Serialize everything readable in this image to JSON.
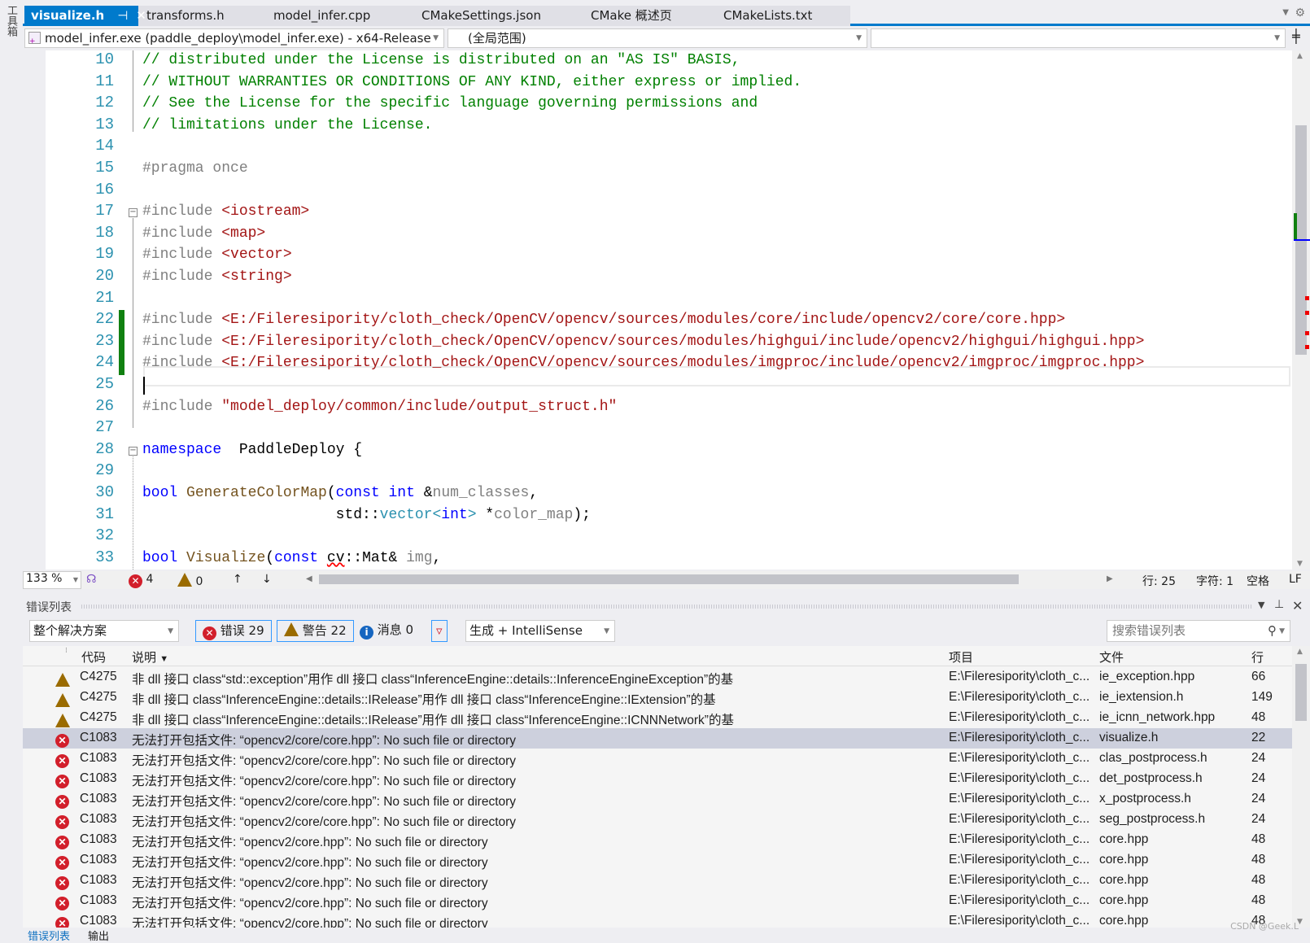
{
  "toolbox_label": "工具箱",
  "tabs": [
    {
      "label": "visualize.h",
      "active": true
    },
    {
      "label": "transforms.h"
    },
    {
      "label": "model_infer.cpp"
    },
    {
      "label": "CMakeSettings.json"
    },
    {
      "label": "CMake 概述页"
    },
    {
      "label": "CMakeLists.txt"
    }
  ],
  "nav": {
    "project": "model_infer.exe (paddle_deploy\\model_infer.exe) - x64-Release",
    "scope": "(全局范围)",
    "member": ""
  },
  "editor": {
    "lines": [
      {
        "n": "10",
        "tokens": [
          [
            "c",
            "// distributed under the License is distributed on an \"AS IS\" BASIS,"
          ]
        ]
      },
      {
        "n": "11",
        "tokens": [
          [
            "c",
            "// WITHOUT WARRANTIES OR CONDITIONS OF ANY KIND, either express or implied."
          ]
        ]
      },
      {
        "n": "12",
        "tokens": [
          [
            "c",
            "// See the License for the specific language governing permissions and"
          ]
        ]
      },
      {
        "n": "13",
        "tokens": [
          [
            "c",
            "// limitations under the License."
          ]
        ]
      },
      {
        "n": "14",
        "tokens": []
      },
      {
        "n": "15",
        "tokens": [
          [
            "p",
            "#pragma once"
          ]
        ]
      },
      {
        "n": "16",
        "tokens": []
      },
      {
        "n": "17",
        "tokens": [
          [
            "p",
            "#include "
          ],
          [
            "s",
            "<iostream>"
          ]
        ]
      },
      {
        "n": "18",
        "tokens": [
          [
            "p",
            "#include "
          ],
          [
            "s",
            "<map>"
          ]
        ]
      },
      {
        "n": "19",
        "tokens": [
          [
            "p",
            "#include "
          ],
          [
            "s",
            "<vector>"
          ]
        ]
      },
      {
        "n": "20",
        "tokens": [
          [
            "p",
            "#include "
          ],
          [
            "s",
            "<string>"
          ]
        ]
      },
      {
        "n": "21",
        "tokens": []
      },
      {
        "n": "22",
        "tokens": [
          [
            "p",
            "#include "
          ],
          [
            "s",
            "<E:/Fileresipority/cloth_check/OpenCV/opencv/sources/modules/core/include/opencv2/core/core.hpp>"
          ]
        ]
      },
      {
        "n": "23",
        "tokens": [
          [
            "p",
            "#include "
          ],
          [
            "s",
            "<E:/Fileresipority/cloth_check/OpenCV/opencv/sources/modules/highgui/include/opencv2/highgui/highgui.hpp>"
          ]
        ]
      },
      {
        "n": "24",
        "tokens": [
          [
            "p",
            "#include "
          ],
          [
            "s",
            "<E:/Fileresipority/cloth_check/OpenCV/opencv/sources/modules/imgproc/include/opencv2/imgproc/imgproc.hpp>"
          ]
        ]
      },
      {
        "n": "25",
        "tokens": []
      },
      {
        "n": "26",
        "tokens": [
          [
            "p",
            "#include "
          ],
          [
            "s",
            "\"model_deploy/common/include/output_struct.h\""
          ]
        ]
      },
      {
        "n": "27",
        "tokens": []
      },
      {
        "n": "28",
        "tokens": [
          [
            "k",
            "namespace"
          ],
          [
            "",
            "  PaddleDeploy {"
          ]
        ]
      },
      {
        "n": "29",
        "tokens": []
      },
      {
        "n": "30",
        "tokens": [
          [
            "k",
            "bool"
          ],
          [
            "",
            " "
          ],
          [
            "f",
            "GenerateColorMap"
          ],
          [
            "",
            "("
          ],
          [
            "k",
            "const"
          ],
          [
            "",
            " "
          ],
          [
            "k",
            "int"
          ],
          [
            "",
            " &"
          ],
          [
            "g",
            "num_classes"
          ],
          [
            "",
            ","
          ]
        ]
      },
      {
        "n": "31",
        "tokens": [
          [
            "",
            "                      std::"
          ],
          [
            "t",
            "vector"
          ],
          [
            "t",
            "<"
          ],
          [
            "k",
            "int"
          ],
          [
            "t",
            "> "
          ],
          [
            "",
            "*"
          ],
          [
            "g",
            "color_map"
          ],
          [
            "",
            ");"
          ]
        ]
      },
      {
        "n": "32",
        "tokens": []
      },
      {
        "n": "33",
        "tokens": [
          [
            "k",
            "bool"
          ],
          [
            "",
            " "
          ],
          [
            "f",
            "Visualize"
          ],
          [
            "",
            "("
          ],
          [
            "k",
            "const"
          ],
          [
            "",
            " "
          ],
          [
            "err",
            "cv"
          ],
          [
            "",
            "::Mat& "
          ],
          [
            "g",
            "img"
          ],
          [
            "",
            ","
          ]
        ]
      }
    ]
  },
  "status": {
    "zoom": "133 %",
    "errors": "4",
    "warnings": "0",
    "line": "行: 25",
    "char": "字符: 1",
    "spaces": "空格",
    "eol": "LF"
  },
  "error_list": {
    "title": "错误列表",
    "scope": "整个解决方案",
    "errors_btn": "错误 29",
    "warnings_btn": "警告 22",
    "messages_btn": "消息 0",
    "source": "生成 + IntelliSense",
    "search_placeholder": "搜索错误列表",
    "columns": {
      "code": "代码",
      "desc": "说明",
      "project": "项目",
      "file": "文件",
      "line": "行"
    },
    "rows": [
      {
        "type": "warning",
        "code": "C4275",
        "desc": "非 dll 接口 class“std::exception”用作 dll 接口 class“InferenceEngine::details::InferenceEngineException”的基",
        "project": "E:\\Fileresipority\\cloth_c...",
        "file": "ie_exception.hpp",
        "line": "66"
      },
      {
        "type": "warning",
        "code": "C4275",
        "desc": "非 dll 接口 class“InferenceEngine::details::IRelease”用作 dll 接口 class“InferenceEngine::IExtension”的基",
        "project": "E:\\Fileresipority\\cloth_c...",
        "file": "ie_iextension.h",
        "line": "149"
      },
      {
        "type": "warning",
        "code": "C4275",
        "desc": "非 dll 接口 class“InferenceEngine::details::IRelease”用作 dll 接口 class“InferenceEngine::ICNNNetwork”的基",
        "project": "E:\\Fileresipority\\cloth_c...",
        "file": "ie_icnn_network.hpp",
        "line": "48"
      },
      {
        "type": "error",
        "selected": true,
        "code": "C1083",
        "desc": "无法打开包括文件: “opencv2/core/core.hpp”: No such file or directory",
        "project": "E:\\Fileresipority\\cloth_c...",
        "file": "visualize.h",
        "line": "22"
      },
      {
        "type": "error",
        "code": "C1083",
        "desc": "无法打开包括文件: “opencv2/core/core.hpp”: No such file or directory",
        "project": "E:\\Fileresipority\\cloth_c...",
        "file": "clas_postprocess.h",
        "line": "24"
      },
      {
        "type": "error",
        "code": "C1083",
        "desc": "无法打开包括文件: “opencv2/core/core.hpp”: No such file or directory",
        "project": "E:\\Fileresipority\\cloth_c...",
        "file": "det_postprocess.h",
        "line": "24"
      },
      {
        "type": "error",
        "code": "C1083",
        "desc": "无法打开包括文件: “opencv2/core/core.hpp”: No such file or directory",
        "project": "E:\\Fileresipority\\cloth_c...",
        "file": "x_postprocess.h",
        "line": "24"
      },
      {
        "type": "error",
        "code": "C1083",
        "desc": "无法打开包括文件: “opencv2/core/core.hpp”: No such file or directory",
        "project": "E:\\Fileresipority\\cloth_c...",
        "file": "seg_postprocess.h",
        "line": "24"
      },
      {
        "type": "error",
        "code": "C1083",
        "desc": "无法打开包括文件: “opencv2/core.hpp”: No such file or directory",
        "project": "E:\\Fileresipority\\cloth_c...",
        "file": "core.hpp",
        "line": "48"
      },
      {
        "type": "error",
        "code": "C1083",
        "desc": "无法打开包括文件: “opencv2/core.hpp”: No such file or directory",
        "project": "E:\\Fileresipority\\cloth_c...",
        "file": "core.hpp",
        "line": "48"
      },
      {
        "type": "error",
        "code": "C1083",
        "desc": "无法打开包括文件: “opencv2/core.hpp”: No such file or directory",
        "project": "E:\\Fileresipority\\cloth_c...",
        "file": "core.hpp",
        "line": "48"
      },
      {
        "type": "error",
        "code": "C1083",
        "desc": "无法打开包括文件: “opencv2/core.hpp”: No such file or directory",
        "project": "E:\\Fileresipority\\cloth_c...",
        "file": "core.hpp",
        "line": "48"
      },
      {
        "type": "error",
        "code": "C1083",
        "desc": "无法打开包括文件: “opencv2/core.hpp”: No such file or directory",
        "project": "E:\\Fileresipority\\cloth_c...",
        "file": "core.hpp",
        "line": "48"
      }
    ]
  },
  "bottom_tabs": [
    "错误列表",
    "输出"
  ],
  "watermark": "CSDN @Geek.L"
}
